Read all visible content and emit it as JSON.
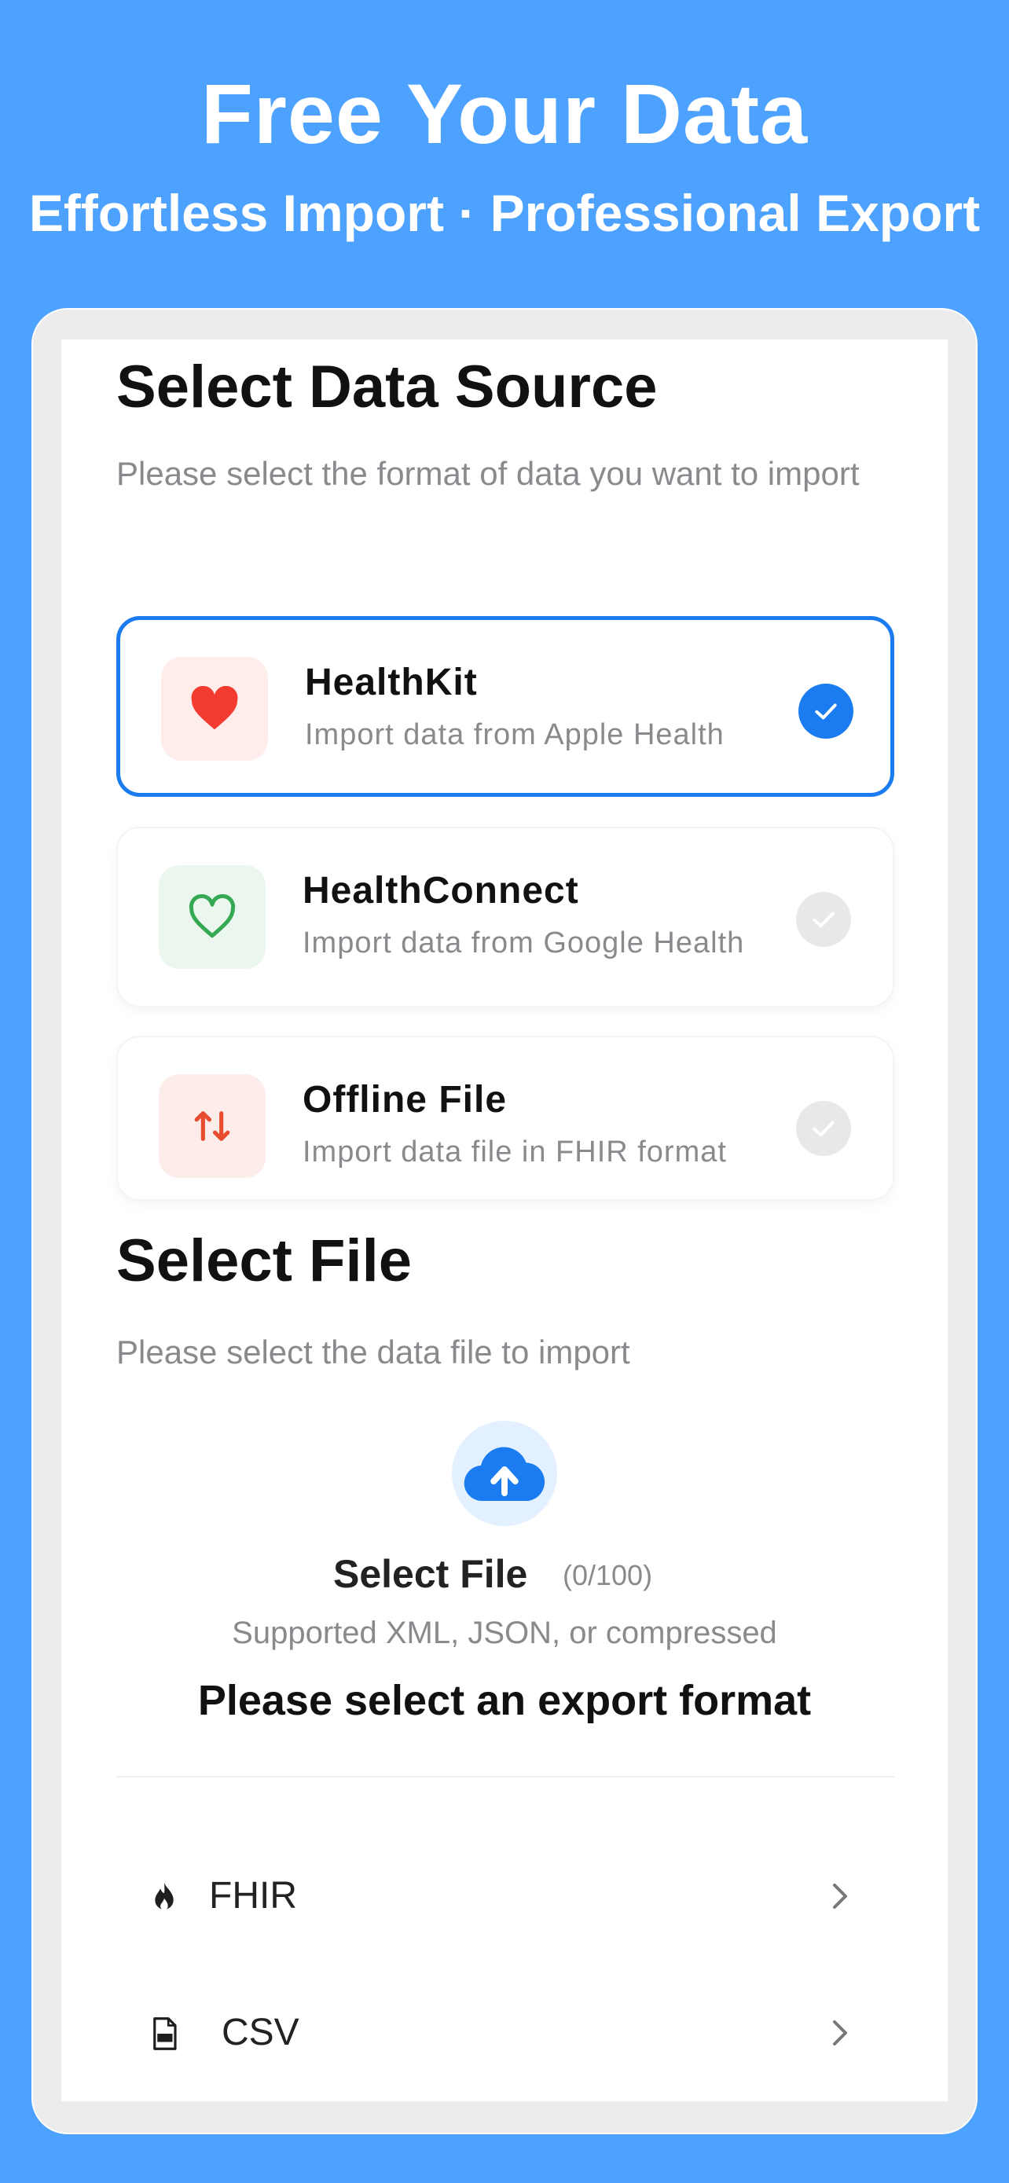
{
  "hero": {
    "title": "Free Your Data",
    "subtitle": "Effortless Import · Professional Export"
  },
  "data_source": {
    "title": "Select Data Source",
    "description": "Please select the format of data you want to import",
    "options": [
      {
        "title": "HealthKit",
        "description": "Import data from Apple Health",
        "selected": true,
        "icon": "heart-filled-icon",
        "icon_color": "#F43B30",
        "icon_bg": "#FFEDEC"
      },
      {
        "title": "HealthConnect",
        "description": "Import data from Google Health",
        "selected": false,
        "icon": "heart-outline-icon",
        "icon_color": "#34A853",
        "icon_bg": "#EBF6EE"
      },
      {
        "title": "Offline File",
        "description": "Import data file in FHIR format",
        "selected": false,
        "icon": "arrows-up-down-icon",
        "icon_color": "#E84C2E",
        "icon_bg": "#FDEDEA"
      }
    ]
  },
  "file": {
    "title": "Select File",
    "description": "Please select the data file to import",
    "button_label": "Select File",
    "count": "(0/100)",
    "supported": "Supported XML, JSON, or compressed",
    "icon": "cloud-upload-icon"
  },
  "export": {
    "heading": "Please select an export format",
    "formats": [
      {
        "label": "FHIR",
        "icon": "flame-icon"
      },
      {
        "label": "CSV",
        "icon": "csv-file-icon"
      }
    ]
  },
  "colors": {
    "background": "#4DA1FF",
    "accent": "#1A7CF0",
    "inactive_check": "#E8E8E8"
  }
}
